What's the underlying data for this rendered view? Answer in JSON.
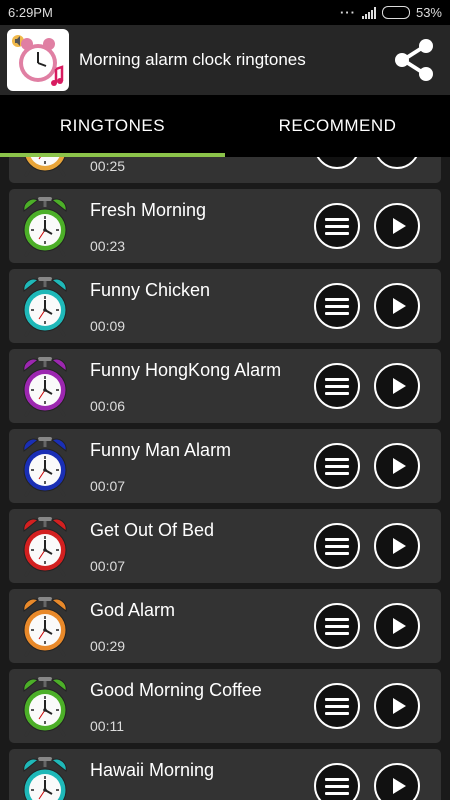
{
  "status_bar": {
    "time": "6:29PM",
    "battery": "53%",
    "battery_level": 0.53
  },
  "app_bar": {
    "title": "Morning alarm clock ringtones",
    "app_icon": "pink-alarm-clock-icon",
    "share_icon": "share-icon"
  },
  "tabs": [
    {
      "label": "RINGTONES",
      "active": true
    },
    {
      "label": "RECOMMEND",
      "active": false
    }
  ],
  "ringtones": [
    {
      "name": "",
      "duration": "00:25",
      "color": "#e8a53a"
    },
    {
      "name": "Fresh Morning",
      "duration": "00:23",
      "color": "#4caf28"
    },
    {
      "name": "Funny Chicken",
      "duration": "00:09",
      "color": "#1fb8b8"
    },
    {
      "name": "Funny HongKong Alarm",
      "duration": "00:06",
      "color": "#9c27b0"
    },
    {
      "name": "Funny Man Alarm",
      "duration": "00:07",
      "color": "#1a2fb5"
    },
    {
      "name": "Get Out Of Bed",
      "duration": "00:07",
      "color": "#d32020"
    },
    {
      "name": "God Alarm",
      "duration": "00:29",
      "color": "#e8892a"
    },
    {
      "name": "Good Morning Coffee",
      "duration": "00:11",
      "color": "#4caf28"
    },
    {
      "name": "Hawaii Morning",
      "duration": "",
      "color": "#1fb8b8"
    }
  ],
  "colors": {
    "accent": "#8bc34a",
    "row_bg": "#333333",
    "app_bar_bg": "#262626"
  }
}
